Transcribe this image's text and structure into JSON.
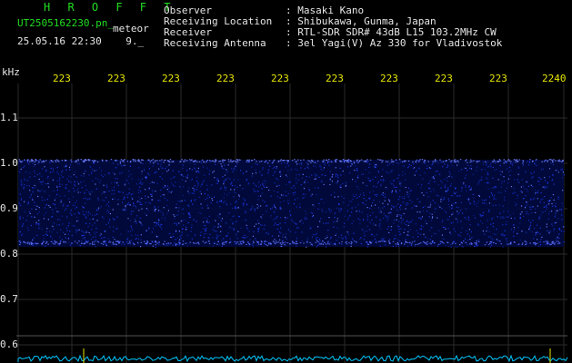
{
  "header": {
    "title": "H R O F F T",
    "file_name": "UT2505162230.pn_",
    "meteor_label": "meteor",
    "datetime": "25.05.16 22:30",
    "count_label": "9._"
  },
  "info": {
    "labels": [
      "Observer",
      "Receiving Location",
      "Receiver",
      "Receiving Antenna"
    ],
    "values": [
      ": Masaki Kano",
      ": Shibukawa, Gunma, Japan",
      ": RTL-SDR SDR# 43dB L15 103.2MHz CW",
      ": 3el Yagi(V) Az 330 for Vladivostok"
    ]
  },
  "axis": {
    "unit": "kHz",
    "x_ticks": [
      "223",
      "223",
      "223",
      "223",
      "223",
      "223",
      "223",
      "223",
      "223",
      "2240"
    ],
    "y_ticks": [
      "1.1",
      "1.0",
      "0.9",
      "0.8",
      "0.7",
      "0.6"
    ]
  },
  "colors": {
    "background": "#000000",
    "grid": "#2a2a2a",
    "signal": "#1f3dff",
    "baseline": "#00c8ff",
    "tick_text": "#e6e600",
    "axis_text": "#e6e6e6",
    "title_text": "#22dd22"
  }
}
